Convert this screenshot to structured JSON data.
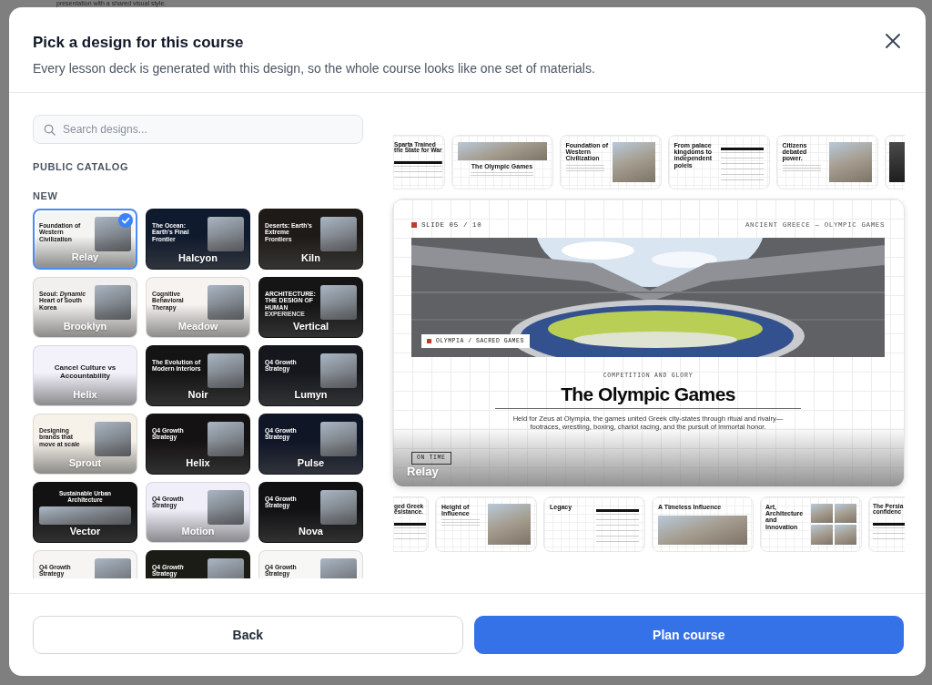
{
  "backdrop": {
    "text": "presentation with a shared visual style."
  },
  "dialog": {
    "title": "Pick a design for this course",
    "subtitle": "Every lesson deck is generated with this design, so the whole course looks like one set of materials."
  },
  "search": {
    "placeholder": "Search designs..."
  },
  "catalog": {
    "heading": "PUBLIC CATALOG",
    "section": "NEW",
    "designs": [
      {
        "name": "Relay",
        "selected": true,
        "color": "#f4f4f2",
        "kind": "split",
        "title": "Foundation of Western Civilization"
      },
      {
        "name": "Halcyon",
        "selected": false,
        "color": "#0f1a2e",
        "kind": "split",
        "title": "The Ocean: Earth's Final Frontier"
      },
      {
        "name": "Kiln",
        "selected": false,
        "color": "#1e1a17",
        "kind": "split",
        "title": "Deserts: Earth's Extreme Frontiers"
      },
      {
        "name": "Brooklyn",
        "selected": false,
        "color": "#f1f0ee",
        "kind": "split",
        "title": "Seoul: *Dynamic* Heart of South Korea"
      },
      {
        "name": "Meadow",
        "selected": false,
        "color": "#f6f3f1",
        "kind": "split",
        "title": "Cognitive Behavioral Therapy"
      },
      {
        "name": "Vertical",
        "selected": false,
        "color": "#151515",
        "kind": "split",
        "title": "ARCHITECTURE: THE DESIGN OF HUMAN EXPERIENCE"
      },
      {
        "name": "Helix",
        "selected": false,
        "color": "#f3f1fa",
        "kind": "centered",
        "title": "Cancel Culture vs Accountability"
      },
      {
        "name": "Noir",
        "selected": false,
        "color": "#141414",
        "kind": "split",
        "title": "The Evolution of Modern Interiors"
      },
      {
        "name": "Lumyn",
        "selected": false,
        "color": "#15171c",
        "kind": "split",
        "title": "Q4 Growth Strategy"
      },
      {
        "name": "Sprout",
        "selected": false,
        "color": "#f6f2ea",
        "kind": "split",
        "title": "Designing brands that move at scale"
      },
      {
        "name": "Helix",
        "selected": false,
        "color": "#141212",
        "kind": "split",
        "title": "Q4 Growth Strategy"
      },
      {
        "name": "Pulse",
        "selected": false,
        "color": "#0f1626",
        "kind": "split",
        "title": "Q4 Growth Strategy"
      },
      {
        "name": "Vector",
        "selected": false,
        "color": "#121212",
        "kind": "banner",
        "title": "Sustainable Urban Architecture"
      },
      {
        "name": "Motion",
        "selected": false,
        "color": "#f0eef8",
        "kind": "split",
        "title": "Q4 Growth Strategy"
      },
      {
        "name": "Nova",
        "selected": false,
        "color": "#111113",
        "kind": "split",
        "title": "Q4 Growth Strategy"
      },
      {
        "selected": false,
        "color": "#f7f5f3",
        "kind": "split",
        "title": "Q4 Growth Strategy"
      },
      {
        "selected": false,
        "color": "#1a1c15",
        "kind": "split",
        "title": "Q4 *Growth* Strategy"
      },
      {
        "selected": false,
        "color": "#f7f7f5",
        "kind": "split",
        "title": "Q4 Growth Strategy"
      }
    ]
  },
  "preview": {
    "top_strip": [
      {
        "kind": "partial-left",
        "title": "Sparta Trained the State for War"
      },
      {
        "kind": "photo-top",
        "title": "The Olympic Games"
      },
      {
        "kind": "photo-right",
        "title": "Foundation of Western Civilization"
      },
      {
        "kind": "table-right",
        "title": "From palace kingdoms to independent poleis"
      },
      {
        "kind": "photo-right",
        "title": "Citizens debated power."
      },
      {
        "kind": "partial-right"
      }
    ],
    "slide": {
      "slide_number": "SLIDE 05 / 10",
      "section": "ANCIENT GREECE — OLYMPIC GAMES",
      "photo_caption": "OLYMPIA / SACRED GAMES",
      "eyebrow": "COMPETITION AND GLORY",
      "title": "The Olympic Games",
      "body": "Held for Zeus at Olympia, the games united Greek city-states through ritual and rivalry—footraces, wrestling, boxing, chariot racing, and the pursuit of immortal honor.",
      "tag": "ON TIME",
      "design_name": "Relay"
    },
    "bottom_strip": [
      {
        "kind": "partial-left",
        "title": "ged Greek esistance."
      },
      {
        "kind": "photo-right",
        "title": "Height of Influence"
      },
      {
        "kind": "table-right",
        "title": "Legacy"
      },
      {
        "kind": "photo-full",
        "title": "A Timeless Influence"
      },
      {
        "kind": "photo-grid",
        "title": "Art, Architecture and Innovation"
      },
      {
        "kind": "partial-right",
        "title": "The Persia confidenc"
      }
    ]
  },
  "buttons": [
    {
      "label": "Back",
      "kind": "secondary"
    },
    {
      "label": "Plan course",
      "kind": "primary"
    }
  ]
}
